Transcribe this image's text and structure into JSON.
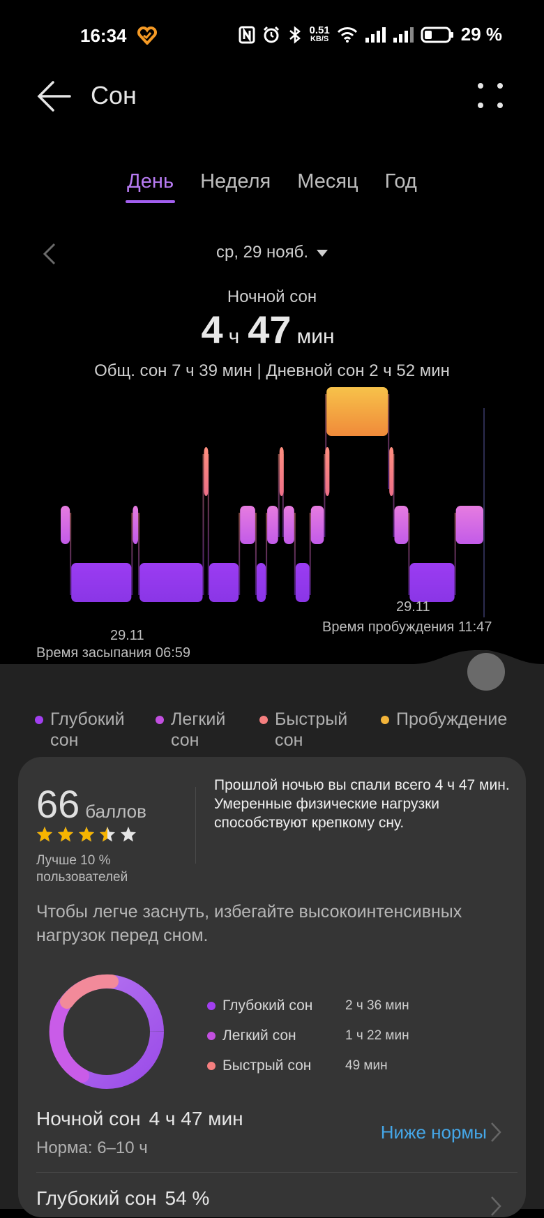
{
  "status_bar": {
    "time": "16:34",
    "speed_value": "0.51",
    "speed_unit": "KB/S",
    "battery": "29 %",
    "icons": [
      "heart-badge-icon",
      "nfc-icon",
      "alarm-icon",
      "bluetooth-icon",
      "wifi-icon",
      "signal-icon",
      "signal-icon-2",
      "battery-icon"
    ]
  },
  "header": {
    "title": "Сон",
    "back_icon": "arrow-left-icon",
    "more_icon": "more-dots-icon"
  },
  "tabs": [
    {
      "label": "День",
      "active": true
    },
    {
      "label": "Неделя",
      "active": false
    },
    {
      "label": "Месяц",
      "active": false
    },
    {
      "label": "Год",
      "active": false
    }
  ],
  "date": {
    "label": "ср, 29 нояб."
  },
  "summary": {
    "night_label": "Ночной сон",
    "hours": "4",
    "hours_unit": "ч",
    "minutes": "47",
    "minutes_unit": "мин",
    "total_line": "Общ. сон 7 ч 39 мин | Дневной сон 2 ч 52 мин"
  },
  "chart_data": {
    "type": "sleep-stages",
    "stage_levels": {
      "awake": 4,
      "rem": 3,
      "light": 2,
      "deep": 1
    },
    "segments": [
      [
        "light",
        0.0
      ],
      [
        "deep",
        0.025
      ],
      [
        "light",
        0.17
      ],
      [
        "deep",
        0.186
      ],
      [
        "rem",
        0.338
      ],
      [
        "deep",
        0.35
      ],
      [
        "light",
        0.423
      ],
      [
        "deep",
        0.462
      ],
      [
        "light",
        0.487
      ],
      [
        "rem",
        0.516
      ],
      [
        "light",
        0.526
      ],
      [
        "deep",
        0.554
      ],
      [
        "light",
        0.59
      ],
      [
        "rem",
        0.624
      ],
      [
        "awake",
        0.627
      ],
      [
        "rem",
        0.775
      ],
      [
        "light",
        0.787
      ],
      [
        "deep",
        0.823
      ],
      [
        "light",
        0.932
      ]
    ],
    "end": 1.0,
    "colors": {
      "deep": "#a23ff0",
      "light": "#c24fe0",
      "rem": "#f57f7f",
      "awake": "#f3b43a"
    },
    "sleep_date": "29.11",
    "sleep_label": "Время засыпания 06:59",
    "wake_date": "29.11",
    "wake_label": "Время пробуждения 11:47"
  },
  "legend": [
    {
      "label": "Глубокий сон",
      "color": "#a23ff0"
    },
    {
      "label": "Легкий сон",
      "color": "#c24fe0"
    },
    {
      "label": "Быстрый сон",
      "color": "#f57f7f"
    },
    {
      "label": "Пробуждение",
      "color": "#f3b43a"
    }
  ],
  "score": {
    "value": "66",
    "unit": "баллов",
    "stars": 3.5,
    "stars_total": 5,
    "better": "Лучше 10 % пользователей",
    "text": "Прошлой ночью вы спали всего 4 ч 47 мин. Умеренные физические нагрузки способствуют крепкому сну."
  },
  "tip": "Чтобы легче заснуть, избегайте высокоинтенсивных нагрузок перед сном.",
  "breakdown": [
    {
      "label": "Глубокий сон",
      "value": "2 ч 36 мин",
      "color": "#a23ff0"
    },
    {
      "label": "Легкий сон",
      "value": "1 ч 22 мин",
      "color": "#c24fe0"
    },
    {
      "label": "Быстрый сон",
      "value": "49 мин",
      "color": "#f57f7f"
    }
  ],
  "night_sleep": {
    "title": "Ночной сон",
    "value": "4 ч 47 мин",
    "norm": "Норма: 6–10 ч",
    "status": "Ниже нормы"
  },
  "deep_sleep": {
    "title": "Глубокий сон",
    "value": "54 %"
  }
}
